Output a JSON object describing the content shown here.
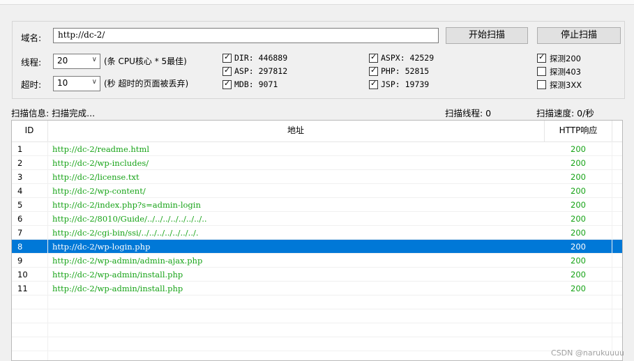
{
  "domain_label": "域名:",
  "domain_value": "http://dc-2/",
  "buttons": {
    "start": "开始扫描",
    "stop": "停止扫描"
  },
  "threads": {
    "label": "线程:",
    "value": "20",
    "hint": "(条 CPU核心 * 5最佳)"
  },
  "timeout": {
    "label": "超时:",
    "value": "10",
    "hint": "(秒 超时的页面被丢弃)"
  },
  "dicts": [
    {
      "text": "DIR: 446889",
      "checked": true
    },
    {
      "text": "ASP: 297812",
      "checked": true
    },
    {
      "text": "MDB: 9071",
      "checked": true
    },
    {
      "text": "ASPX: 42529",
      "checked": true
    },
    {
      "text": "PHP: 52815",
      "checked": true
    },
    {
      "text": "JSP: 19739",
      "checked": true
    }
  ],
  "probes": [
    {
      "text": "探测200",
      "checked": true
    },
    {
      "text": "探测403",
      "checked": false
    },
    {
      "text": "探测3XX",
      "checked": false
    }
  ],
  "status": {
    "info": "扫描信息: 扫描完成...",
    "threads": "扫描线程: 0",
    "speed": "扫描速度: 0/秒"
  },
  "table": {
    "headers": [
      "ID",
      "地址",
      "HTTP响应"
    ],
    "rows": [
      {
        "id": "1",
        "url": "http://dc-2/readme.html",
        "code": "200"
      },
      {
        "id": "2",
        "url": "http://dc-2/wp-includes/",
        "code": "200"
      },
      {
        "id": "3",
        "url": "http://dc-2/license.txt",
        "code": "200"
      },
      {
        "id": "4",
        "url": "http://dc-2/wp-content/",
        "code": "200"
      },
      {
        "id": "5",
        "url": "http://dc-2/index.php?s=admin-login",
        "code": "200"
      },
      {
        "id": "6",
        "url": "http://dc-2/8010/Guide/../../../../../../../..",
        "code": "200"
      },
      {
        "id": "7",
        "url": "http://dc-2/cgi-bin/ssi/../../../../../../../.",
        "code": "200"
      },
      {
        "id": "8",
        "url": "http://dc-2/wp-login.php",
        "code": "200"
      },
      {
        "id": "9",
        "url": "http://dc-2/wp-admin/admin-ajax.php",
        "code": "200"
      },
      {
        "id": "10",
        "url": "http://dc-2/wp-admin/install.php",
        "code": "200"
      },
      {
        "id": "11",
        "url": "http://dc-2/wp-admin/install.php",
        "code": "200"
      }
    ],
    "selected_row": 7
  },
  "watermark": "CSDN @narukuuuu"
}
